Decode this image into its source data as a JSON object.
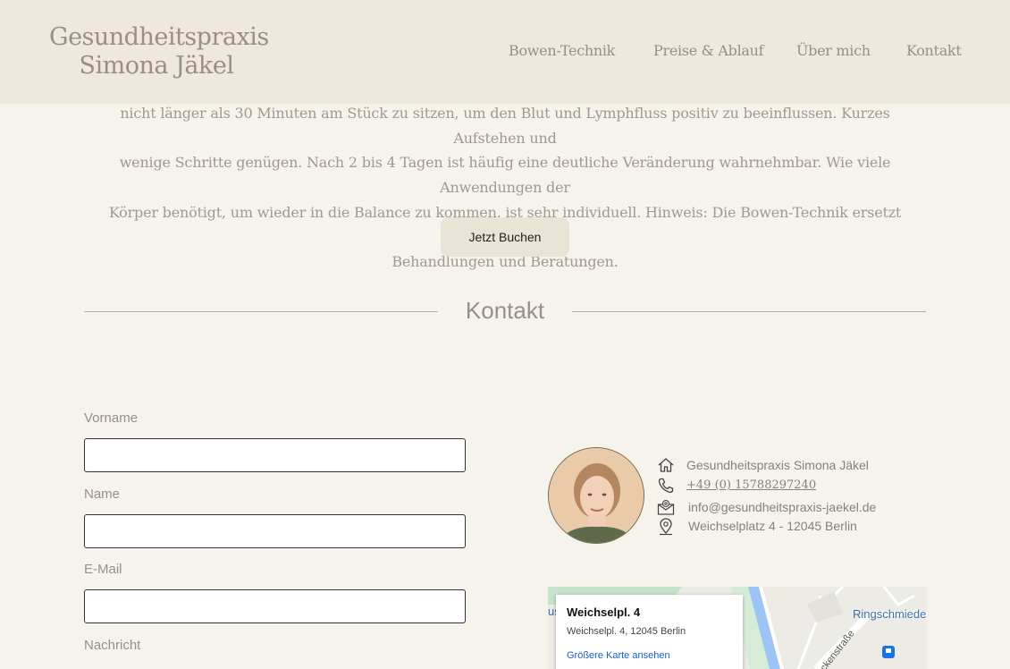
{
  "header": {
    "logo_line1": "Gesundheitspraxis",
    "logo_line2": "Simona Jäkel",
    "nav": [
      "Bowen-Technik",
      "Preise & Ablauf",
      "Über mich",
      "Kontakt"
    ]
  },
  "intro": {
    "lines": [
      "nicht länger als 30 Minuten am Stück zu sitzen, um den Blut und Lymphfluss positiv zu beeinflussen. Kurzes Aufstehen und",
      "wenige Schritte genügen. Nach 2 bis 4 Tagen ist häufig eine deutliche Veränderung wahrnehmbar. Wie viele Anwendungen der",
      "Körper benötigt, um wieder in die Balance zu kommen, ist sehr individuell. Hinweis: Die Bowen-Technik ersetzt keine ärztlichen",
      "Behandlungen und Beratungen."
    ],
    "book_button": "Jetzt Buchen"
  },
  "contact": {
    "title": "Kontakt",
    "form": {
      "vorname_label": "Vorname",
      "name_label": "Name",
      "email_label": "E-Mail",
      "nachricht_label": "Nachricht"
    },
    "info": {
      "practice": "Gesundheitspraxis Simona Jäkel",
      "phone": "+49 (0) 15788297240",
      "email": "info@gesundheitspraxis-jaekel.de",
      "address": "Weichselplatz 4 - 12045 Berlin"
    },
    "map": {
      "card_title": "Weichselpl. 4",
      "card_address": "Weichselpl. 4, 12045 Berlin",
      "card_link": "Größere Karte ansehen",
      "label_ringschmiede": "Ringschmiede",
      "label_street": "ackenstraße",
      "label_left_fragment": "us"
    },
    "icons": [
      "home-icon",
      "phone-icon",
      "mail-icon",
      "location-icon",
      "bus-icon"
    ]
  },
  "colors": {
    "background": "#f5f3ec",
    "header": "#eee9dc",
    "text": "#9a8e85",
    "button": "#eae4d6"
  }
}
